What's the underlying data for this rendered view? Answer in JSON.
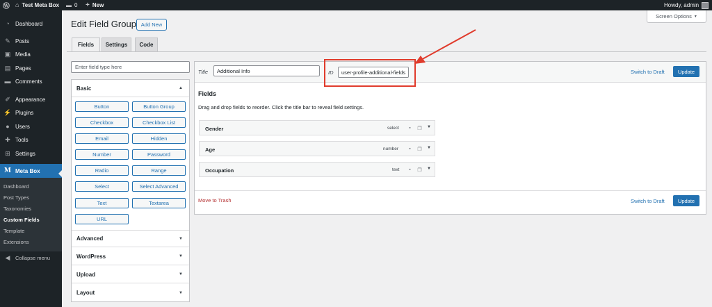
{
  "adminbar": {
    "site_name": "Test Meta Box",
    "comments_count": "0",
    "new_label": "New",
    "greeting": "Howdy, admin"
  },
  "sidebar": {
    "items": [
      {
        "label": "Dashboard",
        "icon": "dashboard-icon",
        "glyph": "◔"
      },
      {
        "label": "Posts",
        "icon": "pin-icon",
        "glyph": "✎"
      },
      {
        "label": "Media",
        "icon": "media-icon",
        "glyph": "▣"
      },
      {
        "label": "Pages",
        "icon": "pages-icon",
        "glyph": "▤"
      },
      {
        "label": "Comments",
        "icon": "comments-icon",
        "glyph": "▬"
      },
      {
        "label": "Appearance",
        "icon": "brush-icon",
        "glyph": "✐"
      },
      {
        "label": "Plugins",
        "icon": "plugin-icon",
        "glyph": "⚡"
      },
      {
        "label": "Users",
        "icon": "users-icon",
        "glyph": "●"
      },
      {
        "label": "Tools",
        "icon": "wrench-icon",
        "glyph": "✚"
      },
      {
        "label": "Settings",
        "icon": "settings-icon",
        "glyph": "⊞"
      },
      {
        "label": "Meta Box",
        "icon": "meta-box-icon",
        "glyph": "M"
      }
    ],
    "submenu": [
      "Dashboard",
      "Post Types",
      "Taxonomies",
      "Custom Fields",
      "Template",
      "Extensions"
    ],
    "collapse_label": "Collapse menu"
  },
  "screen_options": "Screen Options",
  "page": {
    "title": "Edit Field Group",
    "add_new": "Add New",
    "tabs": [
      "Fields",
      "Settings",
      "Code"
    ]
  },
  "field_types": {
    "search_placeholder": "Enter field type here",
    "groups": [
      {
        "name": "Basic",
        "buttons": [
          "Button",
          "Button Group",
          "Checkbox",
          "Checkbox List",
          "Email",
          "Hidden",
          "Number",
          "Password",
          "Radio",
          "Range",
          "Select",
          "Select Advanced",
          "Text",
          "Textarea",
          "URL"
        ]
      },
      {
        "name": "Advanced"
      },
      {
        "name": "WordPress"
      },
      {
        "name": "Upload"
      },
      {
        "name": "Layout"
      }
    ]
  },
  "editor": {
    "title_label": "Title",
    "title_value": "Additional Info",
    "id_label": "ID",
    "id_value": "user-profile-additional-fields",
    "switch_to_draft": "Switch to Draft",
    "update": "Update",
    "fields_heading": "Fields",
    "fields_desc": "Drag and drop fields to reorder. Click the title bar to reveal field settings.",
    "fields": [
      {
        "name": "Gender",
        "type": "select"
      },
      {
        "name": "Age",
        "type": "number"
      },
      {
        "name": "Occupation",
        "type": "text"
      }
    ],
    "move_to_trash": "Move to Trash"
  },
  "colors": {
    "accent": "#2271b1",
    "annotation": "#e03b2c",
    "trash": "#b32d2e",
    "admin_dark": "#1d2327"
  }
}
